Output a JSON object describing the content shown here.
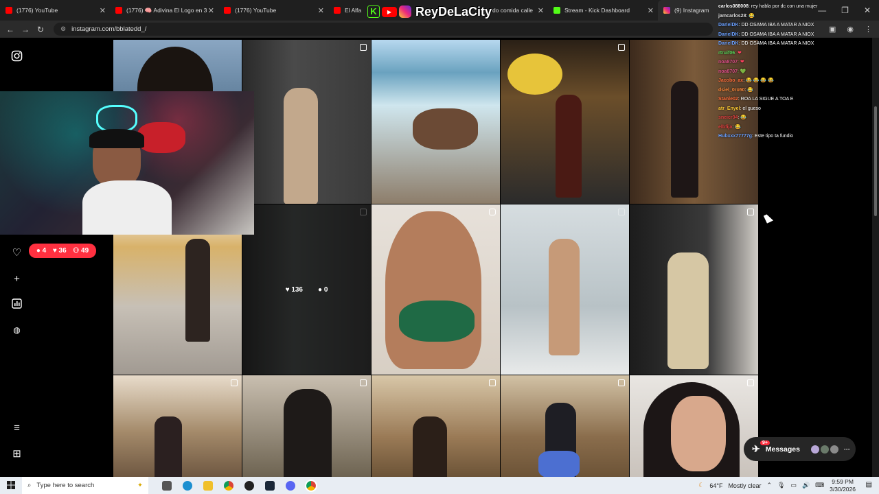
{
  "tabs": [
    {
      "title": "(1776) YouTube",
      "color": "#ff0000"
    },
    {
      "title": "(1776) 🧠 Adivina El Logo en 3",
      "color": "#ff0000"
    },
    {
      "title": "(1776) YouTube",
      "color": "#ff0000"
    },
    {
      "title": "El Alfa",
      "color": "#ff0000"
    },
    {
      "title": "do comida calle",
      "color": "#ff0000"
    },
    {
      "title": "Stream - Kick Dashboard",
      "color": "#53fc18"
    },
    {
      "title": "(9) Instagram",
      "color": "#e1306c"
    }
  ],
  "browser": {
    "url": "instagram.com/bblatedd_/"
  },
  "overlay": {
    "brand": "ReyDeLaCity"
  },
  "chat": [
    {
      "user": "carlos088008",
      "msg": ": rey habla por dc con una mujer",
      "color": "#ffffff"
    },
    {
      "user": "jamcarlos28",
      "msg": ": 😂",
      "color": "#ffffff"
    },
    {
      "user": "DarielDK",
      "msg": ": DD OSAMA IBA A MATAR A NIOX",
      "color": "#6aa0ff"
    },
    {
      "user": "DarielDK",
      "msg": ": DD OSAMA IBA A MATAR A NIOX",
      "color": "#6aa0ff"
    },
    {
      "user": "DarielDK",
      "msg": ": DD OSAMA IBA A MATAR A NIOX",
      "color": "#6aa0ff"
    },
    {
      "user": "rtruif06",
      "msg": ": ❤",
      "color": "#5bd65b"
    },
    {
      "user": "noa8707",
      "msg": ": ❤",
      "color": "#e0508a"
    },
    {
      "user": "noa8707",
      "msg": ": 💚",
      "color": "#e0508a"
    },
    {
      "user": "Jacobo_ax",
      "msg": ": 😂 😂 😂 😂",
      "color": "#ff6f3c"
    },
    {
      "user": "dsiel_0ro50",
      "msg": ": 😂",
      "color": "#ff8a3c"
    },
    {
      "user": "Stanle02",
      "msg": ": ROA LA SIGUE A TOA E",
      "color": "#ff6f3c"
    },
    {
      "user": "atr_Enyel",
      "msg": ": el gueso",
      "color": "#ffcc33"
    },
    {
      "user": "sneicr04",
      "msg": ": 😂",
      "color": "#e04040"
    },
    {
      "user": "elbfija",
      "msg": ": 😂",
      "color": "#e04040"
    },
    {
      "user": "Hubxxx77777g",
      "msg": ": Este tipo ta fundio",
      "color": "#6aa0ff"
    }
  ],
  "notifications": {
    "comments": "4",
    "likes": "36",
    "follows": "49"
  },
  "hover_stats": {
    "likes": "136",
    "comments": "0"
  },
  "messages": {
    "label": "Messages",
    "badge": "9+"
  },
  "taskbar": {
    "search_placeholder": "Type here to search",
    "weather_temp": "64°F",
    "weather_text": "Mostly clear",
    "time": "9:59 PM",
    "date": "3/30/2026"
  }
}
